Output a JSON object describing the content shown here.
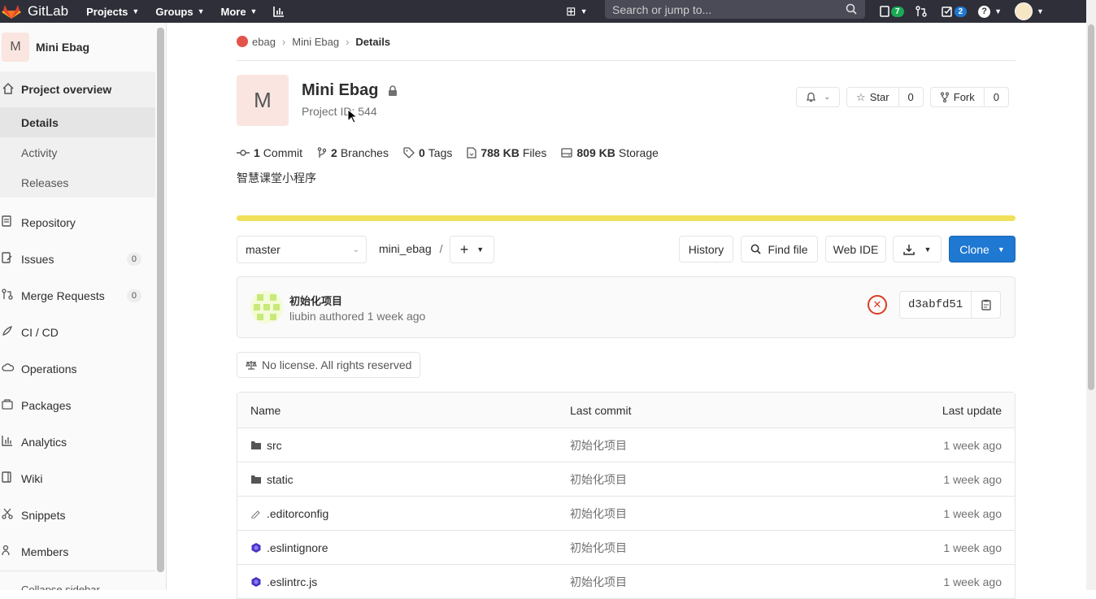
{
  "topbar": {
    "brand": "GitLab",
    "nav": [
      "Projects",
      "Groups",
      "More"
    ],
    "search_placeholder": "Search or jump to...",
    "issues_count": "7",
    "todos_count": "2"
  },
  "sidebar": {
    "context_avatar": "M",
    "context_name": "Mini Ebag",
    "section_title": "Project overview",
    "sub_items": [
      "Details",
      "Activity",
      "Releases"
    ],
    "items": [
      {
        "label": "Repository"
      },
      {
        "label": "Issues",
        "count": "0"
      },
      {
        "label": "Merge Requests",
        "count": "0"
      },
      {
        "label": "CI / CD"
      },
      {
        "label": "Operations"
      },
      {
        "label": "Packages"
      },
      {
        "label": "Analytics"
      },
      {
        "label": "Wiki"
      },
      {
        "label": "Snippets"
      },
      {
        "label": "Members"
      }
    ],
    "collapse_label": "Collapse sidebar"
  },
  "breadcrumb": [
    "ebag",
    "Mini Ebag",
    "Details"
  ],
  "project": {
    "avatar": "M",
    "name": "Mini Ebag",
    "id_text": "Project ID: 544",
    "star_label": "Star",
    "star_count": "0",
    "fork_label": "Fork",
    "fork_count": "0",
    "stats": [
      {
        "value": "1",
        "label": "Commit"
      },
      {
        "value": "2",
        "label": "Branches"
      },
      {
        "value": "0",
        "label": "Tags"
      },
      {
        "value": "788 KB",
        "label": "Files"
      },
      {
        "value": "809 KB",
        "label": "Storage"
      }
    ],
    "description": "智慧课堂小程序",
    "language_color": "#f1e05a"
  },
  "toolbar": {
    "branch": "master",
    "path": "mini_ebag",
    "history": "History",
    "find_file": "Find file",
    "web_ide": "Web IDE",
    "clone": "Clone"
  },
  "commit": {
    "title": "初始化项目",
    "meta": "liubin authored 1 week ago",
    "sha": "d3abfd51"
  },
  "license": "No license. All rights reserved",
  "files": {
    "headers": [
      "Name",
      "Last commit",
      "Last update"
    ],
    "rows": [
      {
        "name": "src",
        "icon": "folder-icon",
        "commit": "初始化项目",
        "date": "1 week ago"
      },
      {
        "name": "static",
        "icon": "folder-icon",
        "commit": "初始化项目",
        "date": "1 week ago"
      },
      {
        "name": ".editorconfig",
        "icon": "editorconfig-icon",
        "commit": "初始化项目",
        "date": "1 week ago"
      },
      {
        "name": ".eslintignore",
        "icon": "eslint-icon",
        "commit": "初始化项目",
        "date": "1 week ago"
      },
      {
        "name": ".eslintrc.js",
        "icon": "eslint-icon",
        "commit": "初始化项目",
        "date": "1 week ago"
      }
    ]
  },
  "colors": {
    "accent": "#1f78d1",
    "error": "#db3b21",
    "topbar": "#2f2f3a"
  }
}
